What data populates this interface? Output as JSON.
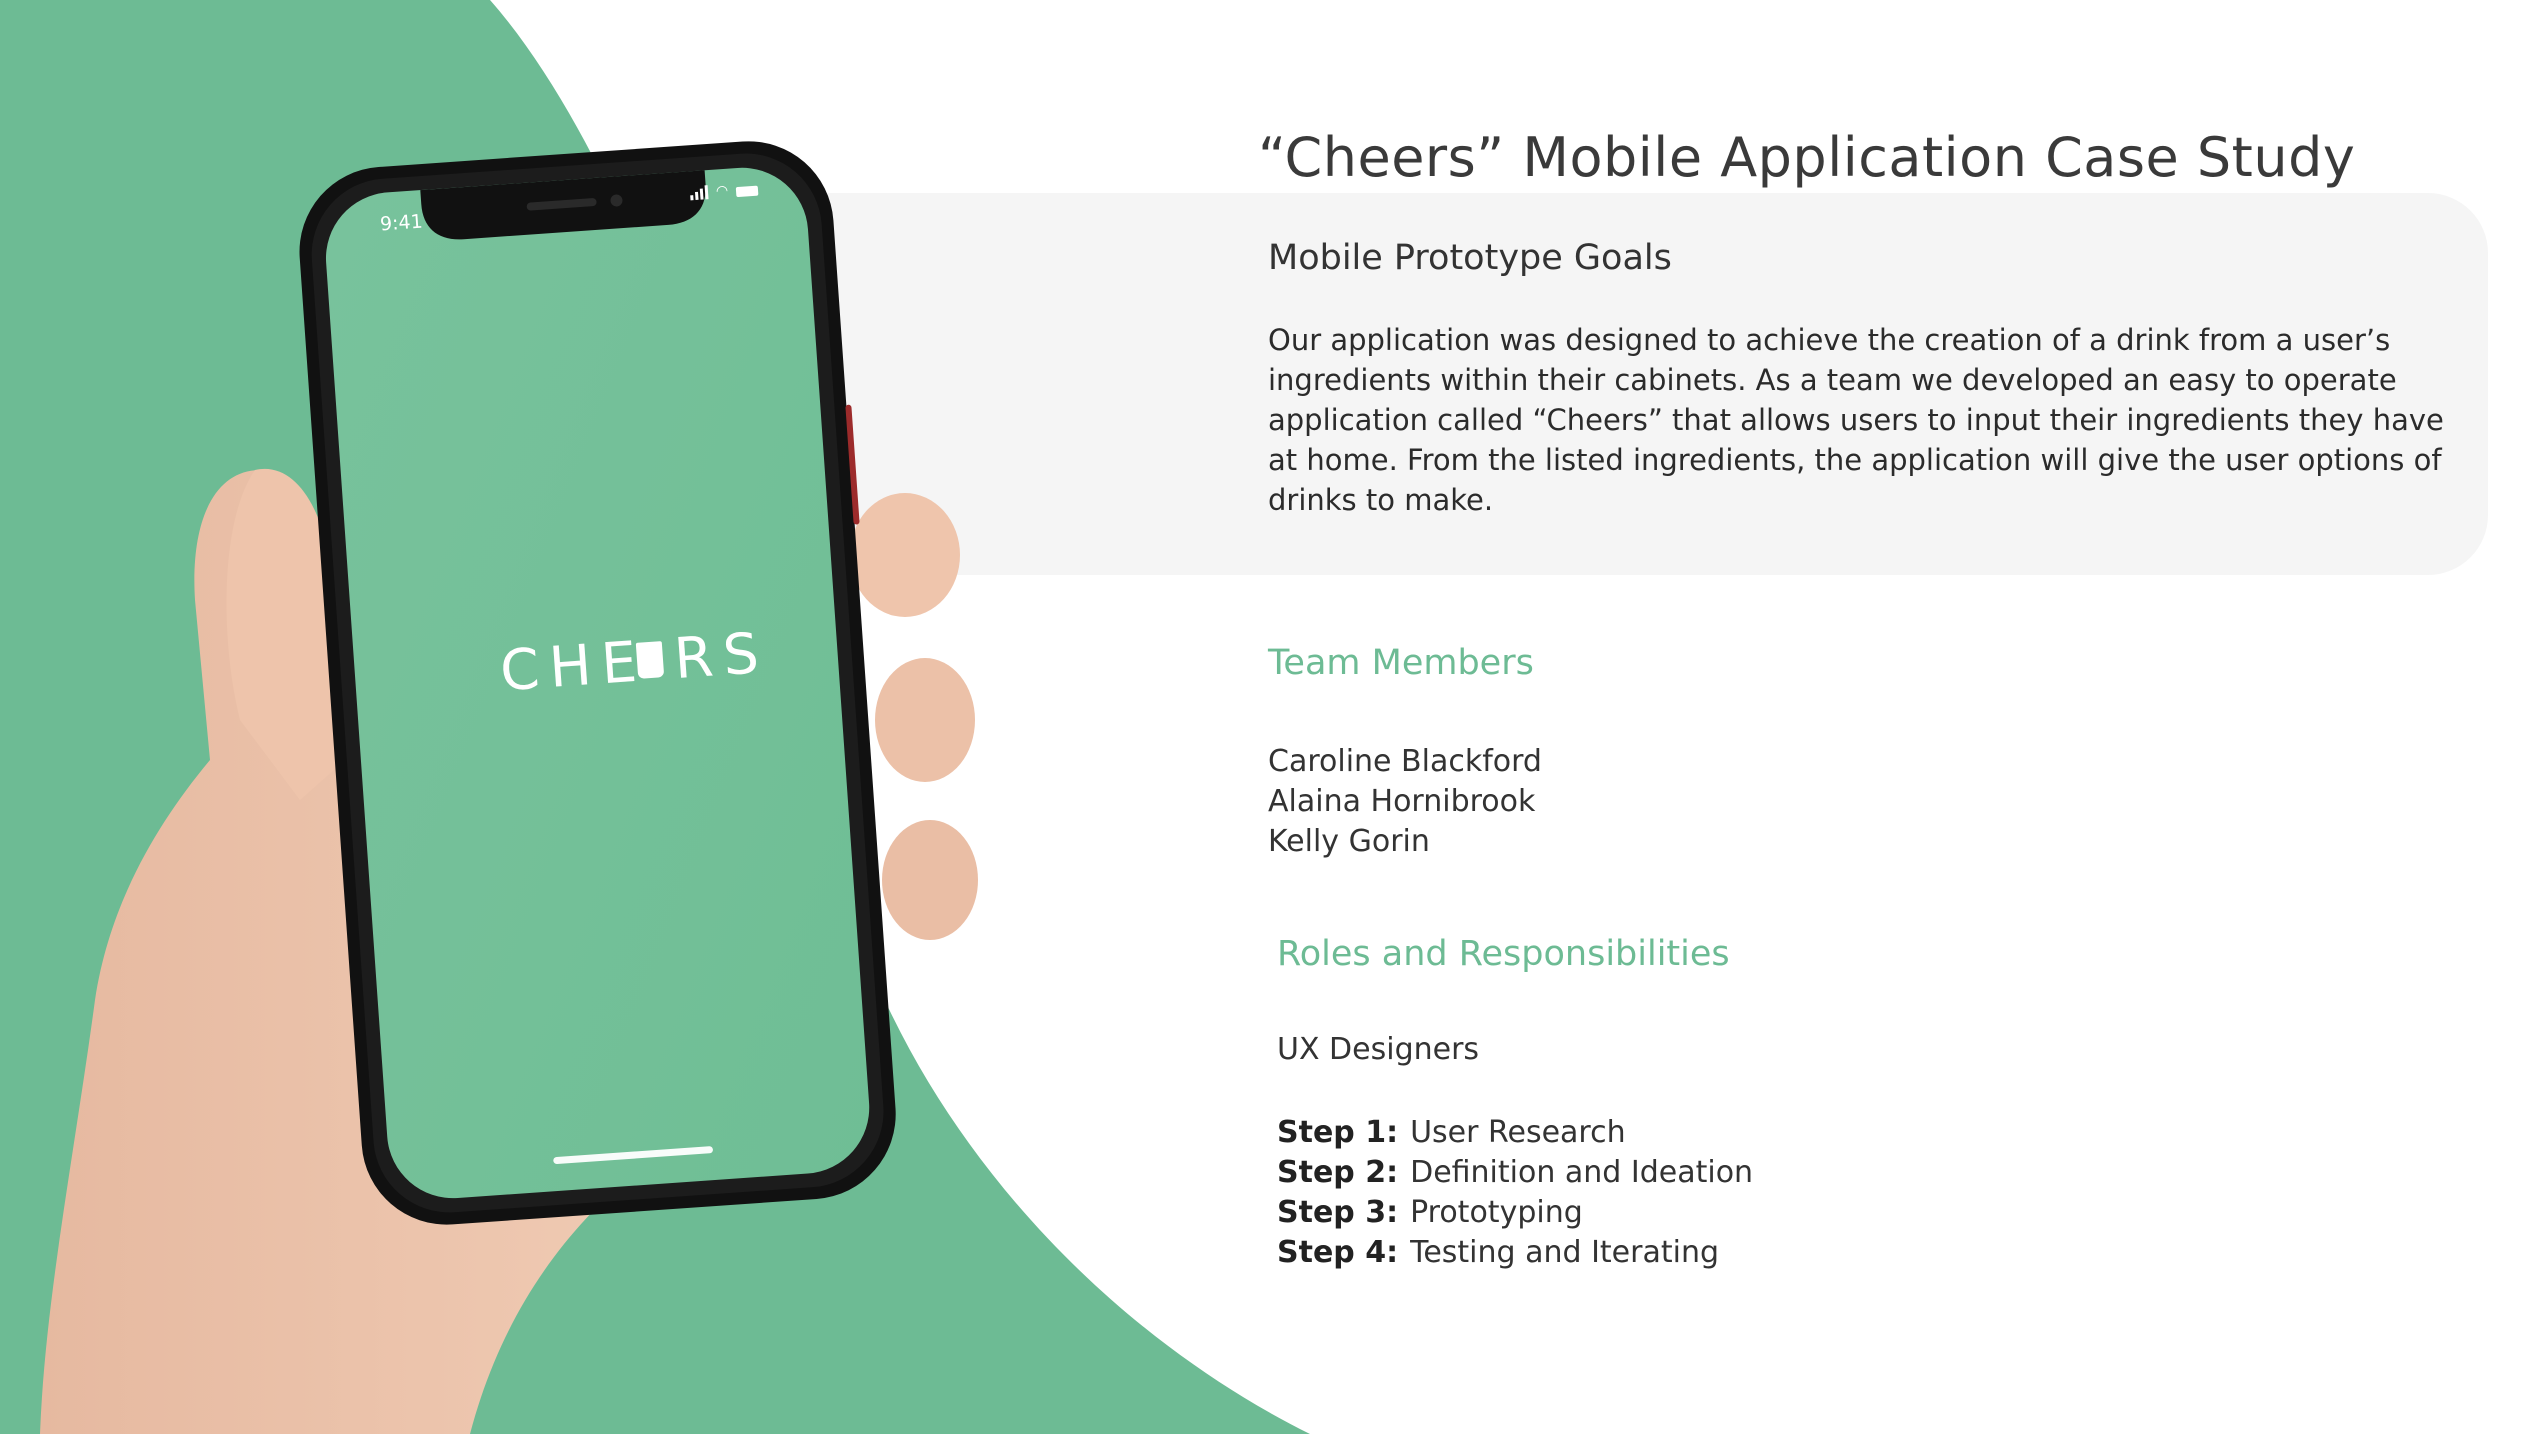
{
  "title": "“Cheers” Mobile Application Case Study",
  "goals": {
    "heading": "Mobile Prototype Goals",
    "body": "Our application was designed to achieve the creation of a drink from a user’s ingredients within their cabinets. As a team we developed an easy to operate application called “Cheers” that allows users to input  their ingredients they have at home. From the listed ingredients, the application will give the user options of drinks to make."
  },
  "team": {
    "heading": "Team Members",
    "members": [
      "Caroline Blackford",
      "Alaina Hornibrook",
      "Kelly Gorin"
    ]
  },
  "roles": {
    "heading": "Roles and Responsibilities",
    "role": "UX Designers",
    "steps": [
      {
        "label": "Step 1:",
        "text": "User Research"
      },
      {
        "label": "Step  2:",
        "text": "Definition and Ideation"
      },
      {
        "label": "Step 3:",
        "text": "Prototyping"
      },
      {
        "label": "Step 4:",
        "text": "Testing and Iterating"
      }
    ]
  },
  "phone": {
    "time": "9:41",
    "logo": "CHE RS"
  },
  "colors": {
    "brand_green": "#6dbb94",
    "panel_gray": "#f5f5f5",
    "text_dark": "#333333"
  }
}
